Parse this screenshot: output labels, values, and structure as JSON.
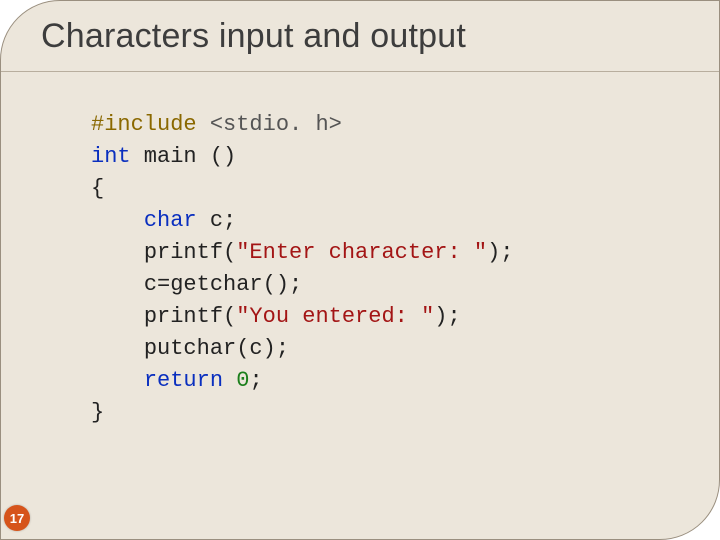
{
  "title": "Characters input and output",
  "slide_number": "17",
  "code": {
    "l1_pp": "#include ",
    "l1_inc": "<stdio. h>",
    "l2_kw": "int",
    "l2_rest": " main ()",
    "l3": "{",
    "l4_kw": "char",
    "l4_rest": " c;",
    "l5_fn": "printf(",
    "l5_str": "\"Enter character: \"",
    "l5_end": ");",
    "l6": "c=getchar();",
    "l7_fn": "printf(",
    "l7_str": "\"You entered: \"",
    "l7_end": ");",
    "l8": "putchar(c);",
    "l9_kw": "return",
    "l9_sp": " ",
    "l9_num": "0",
    "l9_end": ";",
    "l10": "}"
  }
}
